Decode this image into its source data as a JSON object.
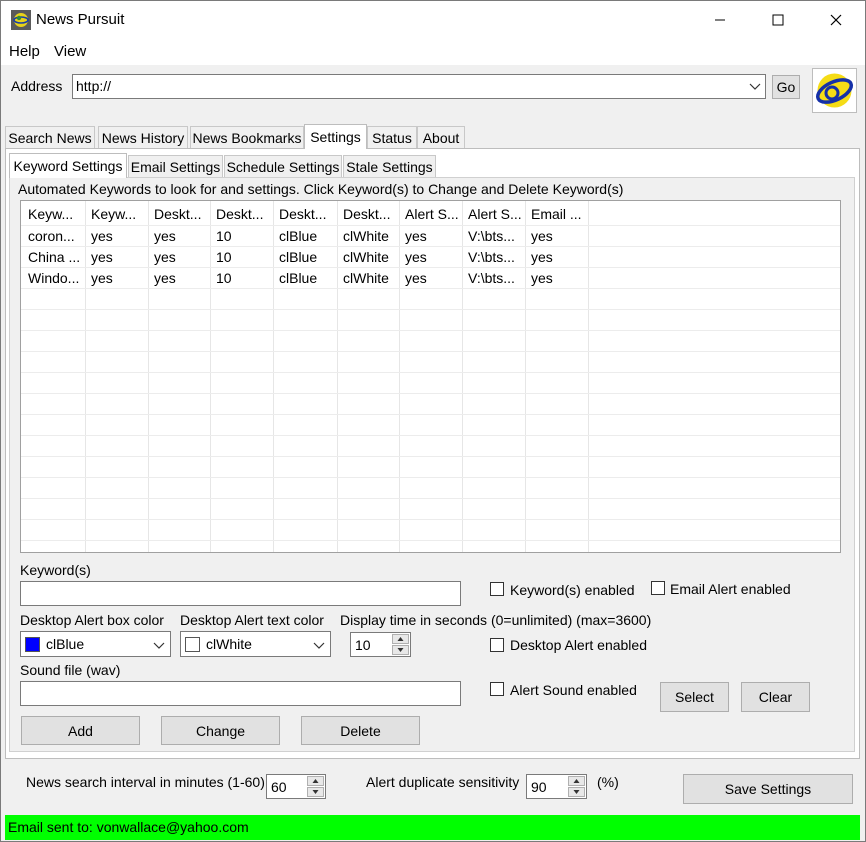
{
  "window": {
    "title": "News Pursuit"
  },
  "menu": [
    "Help",
    "View"
  ],
  "address": {
    "label": "Address",
    "value": "http://",
    "go_label": "Go"
  },
  "tabs": [
    "Search News",
    "News History",
    "News Bookmarks",
    "Settings",
    "Status",
    "About"
  ],
  "subtabs": [
    "Keyword Settings",
    "Email Settings",
    "Schedule Settings",
    "Stale Settings"
  ],
  "keywords_caption": "Automated Keywords to look for and settings. Click Keyword(s) to Change and Delete Keyword(s)",
  "grid": {
    "columns": [
      "Keyw...",
      "Keyw...",
      "Deskt...",
      "Deskt...",
      "Deskt...",
      "Deskt...",
      "Alert S...",
      "Alert S...",
      "Email ..."
    ],
    "rows": [
      [
        "coron...",
        "yes",
        "yes",
        "10",
        "clBlue",
        "clWhite",
        "yes",
        "V:\\bts...",
        "yes"
      ],
      [
        "China ...",
        "yes",
        "yes",
        "10",
        "clBlue",
        "clWhite",
        "yes",
        "V:\\bts...",
        "yes"
      ],
      [
        "Windo...",
        "yes",
        "yes",
        "10",
        "clBlue",
        "clWhite",
        "yes",
        "V:\\bts...",
        "yes"
      ]
    ]
  },
  "form": {
    "keyword_label": "Keyword(s)",
    "keyword_value": "",
    "keyword_enabled_label": "Keyword(s) enabled",
    "email_alert_enabled_label": "Email Alert enabled",
    "box_color_label": "Desktop Alert box color",
    "box_color_value": "clBlue",
    "box_color_hex": "#0000ff",
    "text_color_label": "Desktop Alert text color",
    "text_color_value": "clWhite",
    "text_color_hex": "#ffffff",
    "display_time_label": "Display time in seconds (0=unlimited) (max=3600)",
    "display_time_value": "10",
    "desktop_alert_enabled_label": "Desktop Alert enabled",
    "sound_label": "Sound file (wav)",
    "sound_value": "",
    "alert_sound_enabled_label": "Alert Sound enabled",
    "select_label": "Select",
    "clear_label": "Clear",
    "add_label": "Add",
    "change_label": "Change",
    "delete_label": "Delete"
  },
  "bottom": {
    "interval_label": "News search interval in minutes (1-60)",
    "interval_value": "60",
    "sensitivity_label": "Alert duplicate sensitivity",
    "sensitivity_value": "90",
    "percent_label": "(%)",
    "save_label": "Save Settings"
  },
  "status": {
    "text": "Email sent to: vonwallace@yahoo.com",
    "color": "#00ff00"
  }
}
